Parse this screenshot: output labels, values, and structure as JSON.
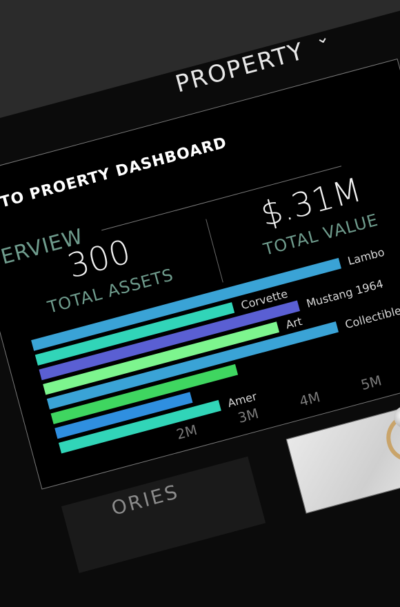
{
  "header": {
    "title": "PROPERTY",
    "caret": "⌄"
  },
  "nav": {
    "back_link": "K TO PROERTY DASHBOARD"
  },
  "overview": {
    "heading": "VERVIEW",
    "total_assets_value": "300",
    "total_assets_label": "TOTAL ASSETS",
    "total_value_value": "$.31M",
    "total_value_label": "TOTAL VALUE"
  },
  "chart_data": {
    "type": "bar",
    "orientation": "horizontal",
    "categories": [
      "Lambo",
      "Mustang 1964",
      "Collectibles",
      "Corvette",
      "Art",
      "Amer"
    ],
    "values": [
      5.0,
      4.2,
      4.7,
      3.2,
      3.8,
      2.6
    ],
    "x_ticks": [
      "2M",
      "3M",
      "4M",
      "5M"
    ],
    "xlim": [
      0,
      5.2
    ],
    "colors": {
      "Lambo": "#3aa3d6",
      "Mustang 1964": "#5a5fd3",
      "Collectibles": "#3aa3d6",
      "Corvette": "#31d5b8",
      "Art": "#7df58e",
      "Amer": "#31d5b8"
    },
    "extra_bars": [
      {
        "value": 3.0,
        "color": "#3fd660"
      },
      {
        "value": 2.2,
        "color": "#2f8fe0"
      }
    ]
  },
  "section": {
    "partial_heading": "ORIES"
  },
  "colors": {
    "background": "#000000",
    "topbar": "#2b2b2b",
    "accent_green": "#6f9c8d",
    "border": "#7a7a7a"
  }
}
